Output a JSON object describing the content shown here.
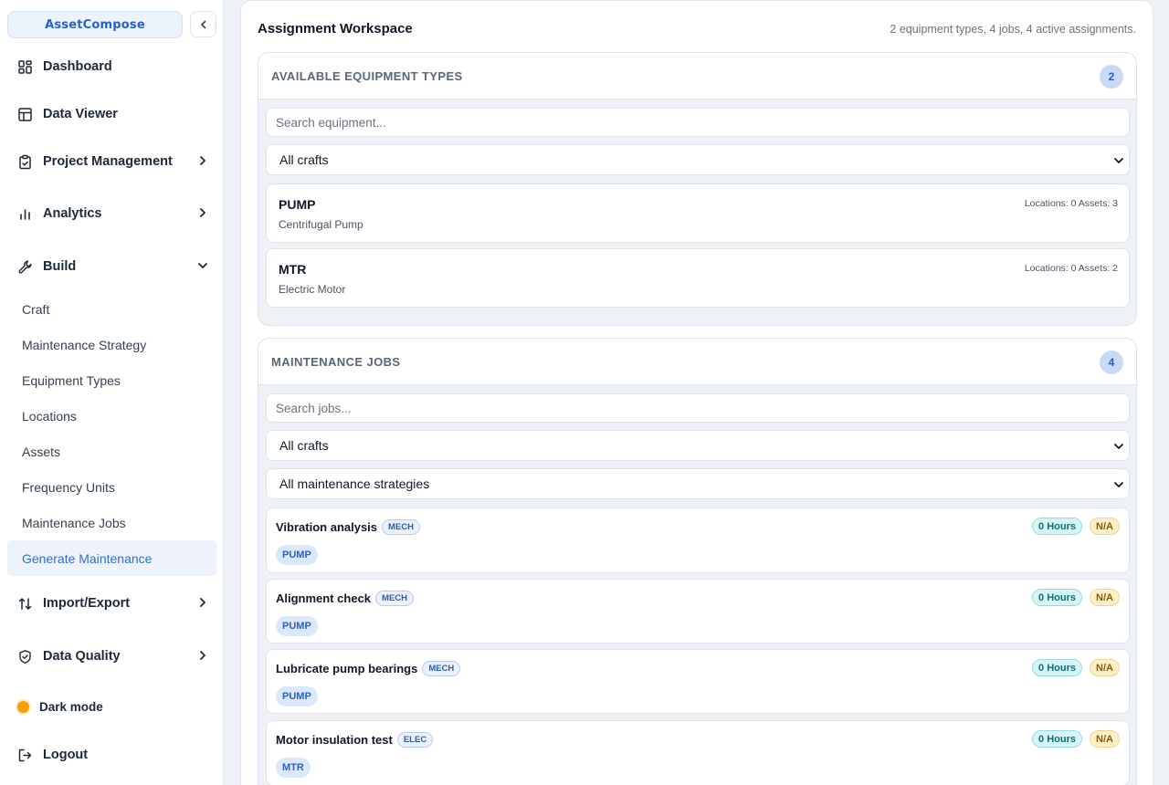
{
  "app": {
    "brand": "AssetCompose"
  },
  "sidebar": {
    "items": [
      {
        "label": "Dashboard",
        "icon": "dashboard-icon"
      },
      {
        "label": "Data Viewer",
        "icon": "table-icon"
      },
      {
        "label": "Project Management",
        "icon": "clipboard-icon"
      },
      {
        "label": "Analytics",
        "icon": "bar-chart-icon"
      },
      {
        "label": "Build",
        "icon": "wrench-icon"
      }
    ],
    "build_sub": [
      "Craft",
      "Maintenance Strategy",
      "Equipment Types",
      "Locations",
      "Assets",
      "Frequency Units",
      "Maintenance Jobs",
      "Generate Maintenance"
    ],
    "lower_items": [
      {
        "label": "Import/Export",
        "icon": "import-export-icon"
      },
      {
        "label": "Data Quality",
        "icon": "shield-icon"
      }
    ],
    "dark_mode": "Dark mode",
    "logout": "Logout"
  },
  "workspace": {
    "title": "Assignment Workspace",
    "summary": "2 equipment types, 4 jobs, 4 active assignments."
  },
  "equipment_panel": {
    "title": "AVAILABLE EQUIPMENT TYPES",
    "count": "2",
    "search_placeholder": "Search equipment...",
    "craft_filter": "All crafts",
    "items": [
      {
        "code": "PUMP",
        "desc": "Centrifugal Pump",
        "meta": "Locations: 0 Assets: 3"
      },
      {
        "code": "MTR",
        "desc": "Electric Motor",
        "meta": "Locations: 0 Assets: 2"
      }
    ]
  },
  "jobs_panel": {
    "title": "MAINTENANCE JOBS",
    "count": "4",
    "search_placeholder": "Search jobs...",
    "craft_filter": "All crafts",
    "strategy_filter": "All maintenance strategies",
    "items": [
      {
        "title": "Vibration analysis",
        "craft": "MECH",
        "hours": "0 Hours",
        "freq": "N/A",
        "equipment": "PUMP"
      },
      {
        "title": "Alignment check",
        "craft": "MECH",
        "hours": "0 Hours",
        "freq": "N/A",
        "equipment": "PUMP"
      },
      {
        "title": "Lubricate pump bearings",
        "craft": "MECH",
        "hours": "0 Hours",
        "freq": "N/A",
        "equipment": "PUMP"
      },
      {
        "title": "Motor insulation test",
        "craft": "ELEC",
        "hours": "0 Hours",
        "freq": "N/A",
        "equipment": "MTR"
      }
    ]
  }
}
